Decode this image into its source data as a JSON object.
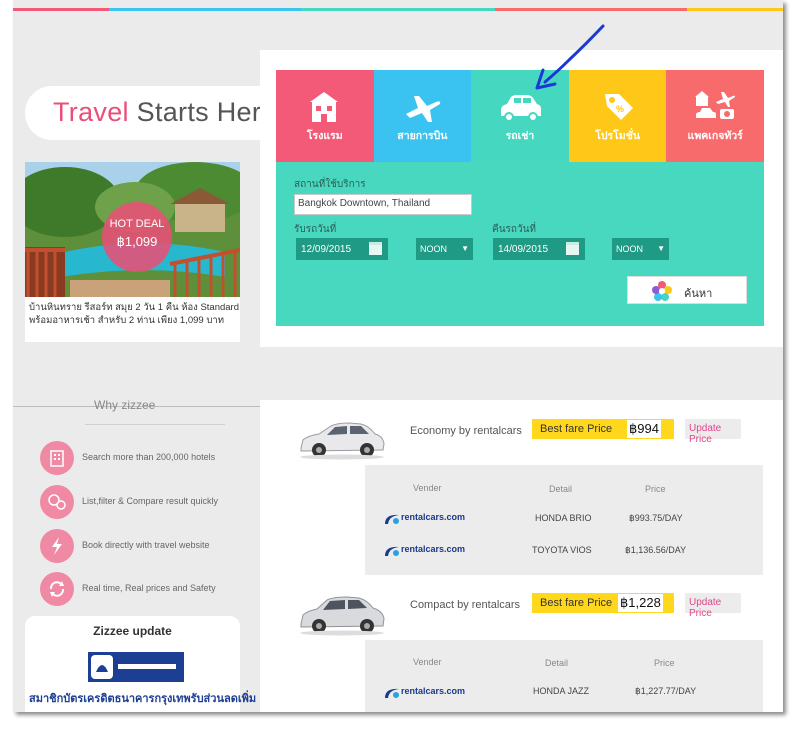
{
  "colors": {
    "pink": "#f25a77",
    "blue": "#3ac3f0",
    "teal": "#45d7bf",
    "yellow": "#ffc818",
    "salmon": "#f86b6d",
    "accent": "#ea4e7a",
    "form_bg": "#48d8c0"
  },
  "hero": {
    "title_accent": "Travel",
    "title_rest": " Starts Here"
  },
  "deal": {
    "badge_line1": "HOT DEAL",
    "badge_line2": "฿1,099",
    "description": "บ้านหินทราย รีสอร์ท สมุย 2 วัน 1 คืน ห้อง Standard พร้อมอาหารเช้า สำหรับ 2 ท่าน เพียง 1,099 บาท"
  },
  "tabs": [
    {
      "label": "โรงแรม",
      "icon": "hotel-icon",
      "color": "#f25a77"
    },
    {
      "label": "สายการบิน",
      "icon": "plane-icon",
      "color": "#3ac3f0"
    },
    {
      "label": "รถเช่า",
      "icon": "car-icon",
      "color": "#45d7bf"
    },
    {
      "label": "โปรโมชั่น",
      "icon": "tag-icon",
      "color": "#ffc818"
    },
    {
      "label": "แพคเกจทัวร์",
      "icon": "package-icon",
      "color": "#f86b6d"
    }
  ],
  "form": {
    "location_label": "สถานที่ใช้บริการ",
    "location_value": "Bangkok Downtown, Thailand",
    "pickup_label": "รับรถวันที่",
    "pickup_date": "12/09/2015",
    "pickup_time": "NOON",
    "return_label": "คืนรถวันที่",
    "return_date": "14/09/2015",
    "return_time": "NOON",
    "search_label": "ค้นหา"
  },
  "why": {
    "title": "Why zizzee",
    "features": [
      {
        "text": "Search more than 200,000 hotels",
        "icon": "building-icon"
      },
      {
        "text": "List,filter & Compare result quickly",
        "icon": "compare-icon"
      },
      {
        "text": "Book directly with travel website",
        "icon": "lightning-icon"
      },
      {
        "text": "Real time, Real prices and Safety",
        "icon": "refresh-icon"
      }
    ]
  },
  "update": {
    "title": "Zizzee update",
    "bank_text": "สมาชิกบัตรเครดิตธนาคารกรุงเทพรับส่วนลดเพิ่ม"
  },
  "results": [
    {
      "title": "Economy by rentalcars",
      "best_label": "Best fare Price",
      "best_price": "฿994",
      "update_label": "Update Price",
      "headers": [
        "Vender",
        "Detail",
        "Price"
      ],
      "rows": [
        {
          "vendor": "rentalcars.com",
          "detail": "HONDA BRIO",
          "price": "฿993.75/DAY"
        },
        {
          "vendor": "rentalcars.com",
          "detail": "TOYOTA VIOS",
          "price": "฿1,136.56/DAY"
        }
      ]
    },
    {
      "title": "Compact by rentalcars",
      "best_label": "Best fare Price",
      "best_price": "฿1,228",
      "update_label": "Update Price",
      "headers": [
        "Vender",
        "Detail",
        "Price"
      ],
      "rows": [
        {
          "vendor": "rentalcars.com",
          "detail": "HONDA JAZZ",
          "price": "฿1,227.77/DAY"
        }
      ]
    }
  ]
}
